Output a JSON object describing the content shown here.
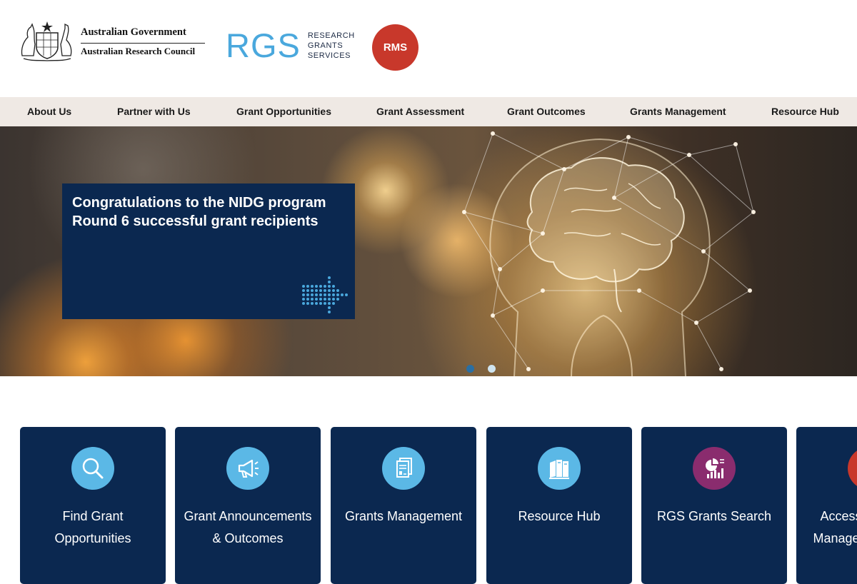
{
  "header": {
    "gov_line1": "Australian Government",
    "gov_line2": "Australian Research Council",
    "rgs_mark": "RGS",
    "rgs_text_1": "RESEARCH",
    "rgs_text_2": "GRANTS",
    "rgs_text_3": "SERVICES",
    "rms_label": "RMS"
  },
  "nav": {
    "items": [
      {
        "label": "About Us"
      },
      {
        "label": "Partner with Us"
      },
      {
        "label": "Grant Opportunities"
      },
      {
        "label": "Grant Assessment"
      },
      {
        "label": "Grant Outcomes"
      },
      {
        "label": "Grants Management"
      },
      {
        "label": "Resource Hub"
      }
    ]
  },
  "hero": {
    "title": "Congratulations to the NIDG program Round 6 successful grant recipients",
    "slide_count": 2,
    "active_slide": 1
  },
  "tiles": [
    {
      "label": "Find Grant Opportunities",
      "icon": "search-icon",
      "color": "#5bb8e6"
    },
    {
      "label": "Grant Announcements & Outcomes",
      "icon": "megaphone-icon",
      "color": "#5bb8e6"
    },
    {
      "label": "Grants Management",
      "icon": "documents-icon",
      "color": "#5bb8e6"
    },
    {
      "label": "Resource Hub",
      "icon": "books-icon",
      "color": "#5bb8e6"
    },
    {
      "label": "RGS Grants Search",
      "icon": "report-chart-icon",
      "color": "#8a2c6e"
    },
    {
      "label": "Access to Grants Management Portal",
      "icon": "portal-icon",
      "color": "#c8382b"
    }
  ],
  "colors": {
    "navy": "#0b2850",
    "nav_bg": "#efe9e4",
    "rgs_blue": "#4aa8dd",
    "rms_red": "#c8382b"
  }
}
